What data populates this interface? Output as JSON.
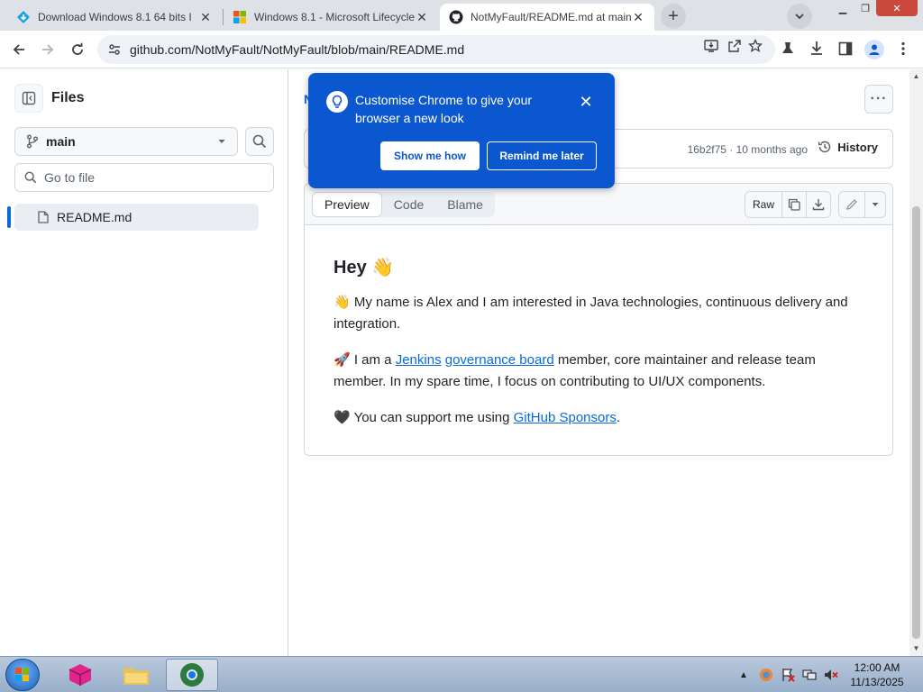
{
  "browser": {
    "tabs": [
      {
        "title": "Download Windows 8.1 64 bits I",
        "icon": "download-favicon-icon"
      },
      {
        "title": "Windows 8.1 - Microsoft Lifecycle",
        "icon": "microsoft-favicon-icon"
      },
      {
        "title": "NotMyFault/README.md at main",
        "icon": "github-favicon-icon"
      }
    ],
    "url": "github.com/NotMyFault/NotMyFault/blob/main/README.md"
  },
  "sidebar": {
    "title": "Files",
    "branch": "main",
    "goto_placeholder": "Go to file",
    "tree": [
      {
        "label": "README.md"
      }
    ]
  },
  "main": {
    "breadcrumb_peek": "N",
    "commit": {
      "meta": "16b2f75 · 10 months ago",
      "history_label": "History"
    },
    "file_tabs": [
      "Preview",
      "Code",
      "Blame"
    ],
    "actions": {
      "raw": "Raw"
    },
    "readme": {
      "heading": "Hey 👋",
      "p1": "👋 My name is Alex and I am interested in Java technologies, continuous delivery and integration.",
      "p2_start": "🚀 I am a ",
      "p2_link1": "Jenkins",
      "p2_link2": "governance board",
      "p2_end": " member, core maintainer and release team member. In my spare time, I focus on contributing to UI/UX components.",
      "p3_start": "🖤 You can support me using ",
      "p3_link": "GitHub Sponsors",
      "p3_end": "."
    }
  },
  "popup": {
    "text": "Customise Chrome to give your browser a new look",
    "show_label": "Show me how",
    "remind_label": "Remind me later"
  },
  "taskbar": {
    "time": "12:00 AM",
    "date": "11/13/2025"
  },
  "colors": {
    "accent": "#0969da",
    "popup": "#0b57d0",
    "taskbar": "#a9bdd6"
  }
}
